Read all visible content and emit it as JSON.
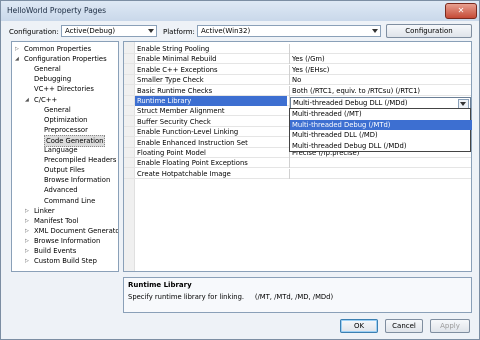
{
  "window": {
    "title": "HelloWorld Property Pages",
    "close_glyph": "✕"
  },
  "config_bar": {
    "configuration_label": "Configuration:",
    "configuration_value": "Active(Debug)",
    "platform_label": "Platform:",
    "platform_value": "Active(Win32)",
    "config_manager_label": "Configuration Manager..."
  },
  "tree": {
    "items": [
      {
        "label": "Common Properties",
        "arrow": "▷"
      },
      {
        "label": "Configuration Properties",
        "arrow": "◢"
      },
      {
        "label": "General"
      },
      {
        "label": "Debugging"
      },
      {
        "label": "VC++ Directories"
      },
      {
        "label": "C/C++",
        "arrow": "◢"
      },
      {
        "label": "General"
      },
      {
        "label": "Optimization"
      },
      {
        "label": "Preprocessor"
      },
      {
        "label": "Code Generation",
        "selected": true
      },
      {
        "label": "Language"
      },
      {
        "label": "Precompiled Headers"
      },
      {
        "label": "Output Files"
      },
      {
        "label": "Browse Information"
      },
      {
        "label": "Advanced"
      },
      {
        "label": "Command Line"
      },
      {
        "label": "Linker",
        "arrow": "▷"
      },
      {
        "label": "Manifest Tool",
        "arrow": "▷"
      },
      {
        "label": "XML Document Generator",
        "arrow": "▷"
      },
      {
        "label": "Browse Information",
        "arrow": "▷"
      },
      {
        "label": "Build Events",
        "arrow": "▷"
      },
      {
        "label": "Custom Build Step",
        "arrow": "▷"
      }
    ]
  },
  "grid": {
    "rows": [
      {
        "name": "Enable String Pooling",
        "value": ""
      },
      {
        "name": "Enable Minimal Rebuild",
        "value": "Yes (/Gm)"
      },
      {
        "name": "Enable C++ Exceptions",
        "value": "Yes (/EHsc)"
      },
      {
        "name": "Smaller Type Check",
        "value": "No"
      },
      {
        "name": "Basic Runtime Checks",
        "value": "Both (/RTC1, equiv. to /RTCsu) (/RTC1)"
      },
      {
        "name": "Runtime Library",
        "value": "Multi-threaded Debug DLL (/MDd)",
        "selected": true
      },
      {
        "name": "Struct Member Alignment",
        "value": ""
      },
      {
        "name": "Buffer Security Check",
        "value": ""
      },
      {
        "name": "Enable Function-Level Linking",
        "value": ""
      },
      {
        "name": "Enable Enhanced Instruction Set",
        "value": ""
      },
      {
        "name": "Floating Point Model",
        "value": "Precise (/fp:precise)"
      },
      {
        "name": "Enable Floating Point Exceptions",
        "value": ""
      },
      {
        "name": "Create Hotpatchable Image",
        "value": ""
      }
    ],
    "dropdown": {
      "current": "Multi-threaded Debug DLL (/MDd)",
      "options": [
        {
          "label": "Multi-threaded (/MT)"
        },
        {
          "label": "Multi-threaded Debug (/MTd)",
          "highlighted": true
        },
        {
          "label": "Multi-threaded DLL (/MD)"
        },
        {
          "label": "Multi-threaded Debug DLL (/MDd)"
        }
      ]
    }
  },
  "description": {
    "title": "Runtime Library",
    "text": "Specify runtime library for linking.     (/MT, /MTd, /MD, /MDd)"
  },
  "buttons": {
    "ok": "OK",
    "cancel": "Cancel",
    "apply": "Apply"
  },
  "colors": {
    "selection": "#3d6fd1",
    "frame": "#7c8ea3"
  }
}
